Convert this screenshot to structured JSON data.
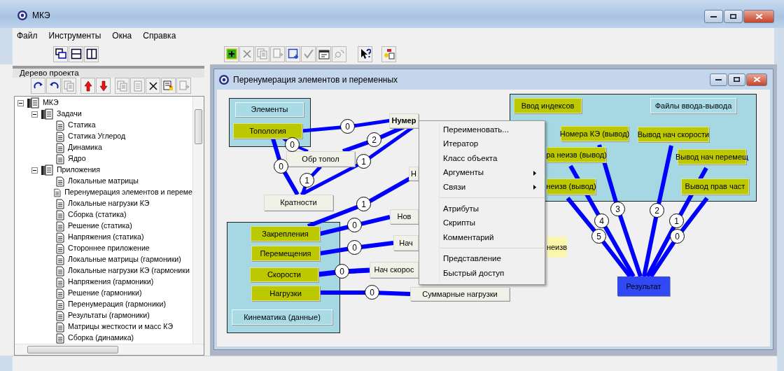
{
  "window": {
    "title": "МКЭ"
  },
  "menu": [
    "Файл",
    "Инструменты",
    "Окна",
    "Справка"
  ],
  "toolbar": {
    "groups": [
      [
        {
          "kind": "cascade",
          "disabled": false
        },
        {
          "kind": "tileh",
          "disabled": false
        },
        {
          "kind": "tilev",
          "disabled": false
        }
      ],
      [
        {
          "kind": "add",
          "disabled": false
        },
        {
          "kind": "delete",
          "disabled": true
        },
        {
          "kind": "copy",
          "disabled": true
        },
        {
          "kind": "move",
          "disabled": true
        },
        {
          "kind": "select",
          "disabled": false
        },
        {
          "kind": "apply",
          "disabled": true
        },
        {
          "kind": "properties",
          "disabled": false
        },
        {
          "kind": "refresh",
          "disabled": true
        }
      ],
      [
        {
          "kind": "help",
          "disabled": false
        }
      ],
      [
        {
          "kind": "arrange",
          "disabled": false
        }
      ]
    ]
  },
  "project_tree": {
    "title": "Дерево проекта",
    "toolbar": [
      [
        {
          "kind": "redo",
          "disabled": false
        },
        {
          "kind": "undo",
          "disabled": false
        },
        {
          "kind": "copy",
          "disabled": true
        }
      ],
      [
        {
          "kind": "up",
          "disabled": false
        },
        {
          "kind": "down",
          "disabled": false
        }
      ],
      [
        {
          "kind": "copy",
          "disabled": true
        },
        {
          "kind": "paste",
          "disabled": true
        },
        {
          "kind": "delete",
          "disabled": false
        },
        {
          "kind": "import",
          "disabled": false
        },
        {
          "kind": "move",
          "disabled": true
        }
      ]
    ],
    "items": [
      {
        "label": "МКЭ",
        "expanded": true,
        "children": [
          {
            "label": "Задачи",
            "expanded": true,
            "children": [
              {
                "label": "Статика"
              },
              {
                "label": "Статика Углерод"
              },
              {
                "label": "Динамика"
              },
              {
                "label": "Ядро"
              }
            ]
          },
          {
            "label": "Приложения",
            "expanded": true,
            "children": [
              {
                "label": "Локальные матрицы"
              },
              {
                "label": "Перенумерация элементов и переме"
              },
              {
                "label": "Локальные нагрузки КЭ"
              },
              {
                "label": "Сборка (статика)"
              },
              {
                "label": "Решение (статика)"
              },
              {
                "label": "Напряжения (статика)"
              },
              {
                "label": "Стороннее приложение"
              },
              {
                "label": "Локальные матрицы (гармоники)"
              },
              {
                "label": "Локальные нагрузки КЭ (гармоники"
              },
              {
                "label": "Напряжения (гармоники)"
              },
              {
                "label": "Решение (гармоники)"
              },
              {
                "label": "Перенумерация (гармоники)"
              },
              {
                "label": "Результаты (гармоники)"
              },
              {
                "label": "Матрицы жесткости и масс КЭ"
              },
              {
                "label": "Сборка (динамика)"
              }
            ]
          }
        ]
      }
    ]
  },
  "child_window": {
    "title": "Перенумерация элементов и переменных",
    "nodes": [
      {
        "label": "Элементы",
        "kind": "data",
        "selected": false
      },
      {
        "label": "Топология",
        "kind": "module",
        "selected": false
      },
      {
        "label": "Обр топол",
        "kind": "process",
        "selected": false
      },
      {
        "label": "Кратности",
        "kind": "process",
        "selected": false
      },
      {
        "label": "Нумер",
        "kind": "process",
        "selected": true
      },
      {
        "label": "Н",
        "kind": "process",
        "selected": false
      },
      {
        "label": "Нов",
        "kind": "process",
        "selected": false
      },
      {
        "label": "Нач",
        "kind": "process",
        "selected": false
      },
      {
        "label": "Нач скорос",
        "kind": "process",
        "selected": false
      },
      {
        "label": "Суммарные нагрузки",
        "kind": "process",
        "selected": false
      },
      {
        "label": "Закрепления",
        "kind": "module",
        "selected": false
      },
      {
        "label": "Перемещения",
        "kind": "module",
        "selected": false
      },
      {
        "label": "Скорости",
        "kind": "module",
        "selected": false
      },
      {
        "label": "Нагрузки",
        "kind": "module",
        "selected": false
      },
      {
        "label": "Кинематика (данные)",
        "kind": "data",
        "selected": false
      },
      {
        "label": "Ввод индексов",
        "kind": "module",
        "selected": false
      },
      {
        "label": "Файлы ввода-вывода",
        "kind": "data",
        "selected": false
      },
      {
        "label": "Номера КЭ (вывод)",
        "kind": "module",
        "selected": false
      },
      {
        "label": "Вывод нач скорости",
        "kind": "module",
        "selected": false
      },
      {
        "label": "ра неизв (вывод)",
        "kind": "module",
        "selected": false
      },
      {
        "label": "Вывод нач перемещ",
        "kind": "module",
        "selected": false
      },
      {
        "label": "неизв (вывод)",
        "kind": "module",
        "selected": false
      },
      {
        "label": "Вывод прав част",
        "kind": "module",
        "selected": false
      },
      {
        "label": "неизв",
        "kind": "highlight",
        "selected": false
      },
      {
        "label": "Результат",
        "kind": "result",
        "selected": false
      }
    ],
    "links": [
      {
        "label": "0"
      },
      {
        "label": "0"
      },
      {
        "label": "0"
      },
      {
        "label": "2"
      },
      {
        "label": "1"
      },
      {
        "label": "1"
      },
      {
        "label": "1"
      },
      {
        "label": "0"
      },
      {
        "label": "0"
      },
      {
        "label": "0"
      },
      {
        "label": "0"
      },
      {
        "label": "3"
      },
      {
        "label": "2"
      },
      {
        "label": "4"
      },
      {
        "label": "5"
      },
      {
        "label": "1"
      },
      {
        "label": "0"
      }
    ]
  },
  "context_menu": {
    "sections": [
      [
        {
          "label": "Переименовать...",
          "submenu": false
        },
        {
          "label": "Итератор",
          "submenu": false
        },
        {
          "label": "Класс объекта",
          "submenu": false
        },
        {
          "label": "Аргументы",
          "submenu": true
        },
        {
          "label": "Связи",
          "submenu": true
        }
      ],
      [
        {
          "label": "Атрибуты",
          "submenu": false
        },
        {
          "label": "Скрипты",
          "submenu": false
        },
        {
          "label": "Комментарий",
          "submenu": false
        }
      ],
      [
        {
          "label": "Представление",
          "submenu": false
        },
        {
          "label": "Быстрый доступ",
          "submenu": false
        }
      ]
    ]
  }
}
